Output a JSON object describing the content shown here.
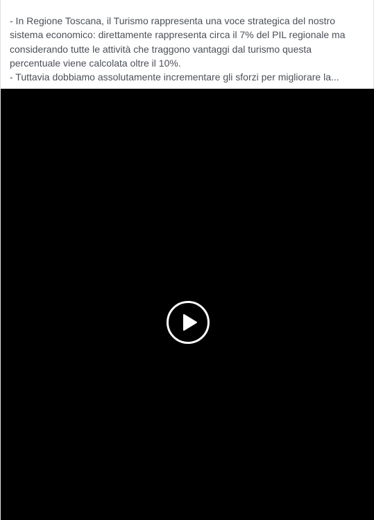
{
  "post": {
    "text_lines": [
      "- In Regione Toscana, il Turismo rappresenta una voce strategica del nostro",
      "sistema economico: direttamente rappresenta circa il 7% del PIL regionale ma",
      "considerando tutte le attività che traggono vantaggi dal turismo questa",
      "percentuale viene calcolata oltre il 10%.",
      "- Tuttavia dobbiamo assolutamente incrementare gli sforzi per migliorare la..."
    ]
  },
  "video": {
    "play_icon": "play-icon",
    "background_color": "#000000"
  }
}
